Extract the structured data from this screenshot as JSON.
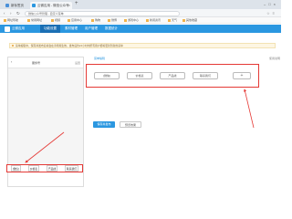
{
  "browser": {
    "tabs": [
      {
        "label": "新标签页",
        "icon": "globe-icon"
      },
      {
        "label": "云微应用 - 微信公众号",
        "icon": "app-icon"
      }
    ],
    "url": "微信公众号管理 - 自定义菜单",
    "bookmarks": [
      "网址导航",
      "常用网址",
      "视频",
      "应用中心",
      "购物",
      "微博",
      "游戏中心",
      "新闻资讯",
      "天气",
      "其他收藏"
    ]
  },
  "app": {
    "name": "云微应用",
    "nav": [
      "功能设置",
      "素材管理",
      "用户管理",
      "数据统计"
    ],
    "active_nav": 0,
    "brand_color": "#2b97e0"
  },
  "tip": "菜单编辑中，保存并发布后将会在手机端生效，发布后约24小时内所有用户都将更新到新的菜单",
  "phone": {
    "title": "服务号",
    "right_label": "设置",
    "menu": [
      "[微信]",
      "价格表",
      "产品线",
      "联系我们"
    ]
  },
  "editor": {
    "heading": "菜单编辑",
    "link": "使用说明",
    "menu": [
      "[微信]",
      "价格表",
      "产品线",
      "联系我们"
    ],
    "add_label": "+",
    "save_label": "保存并发布",
    "preview_label": "预览效果"
  },
  "annotation_color": "#e53935"
}
